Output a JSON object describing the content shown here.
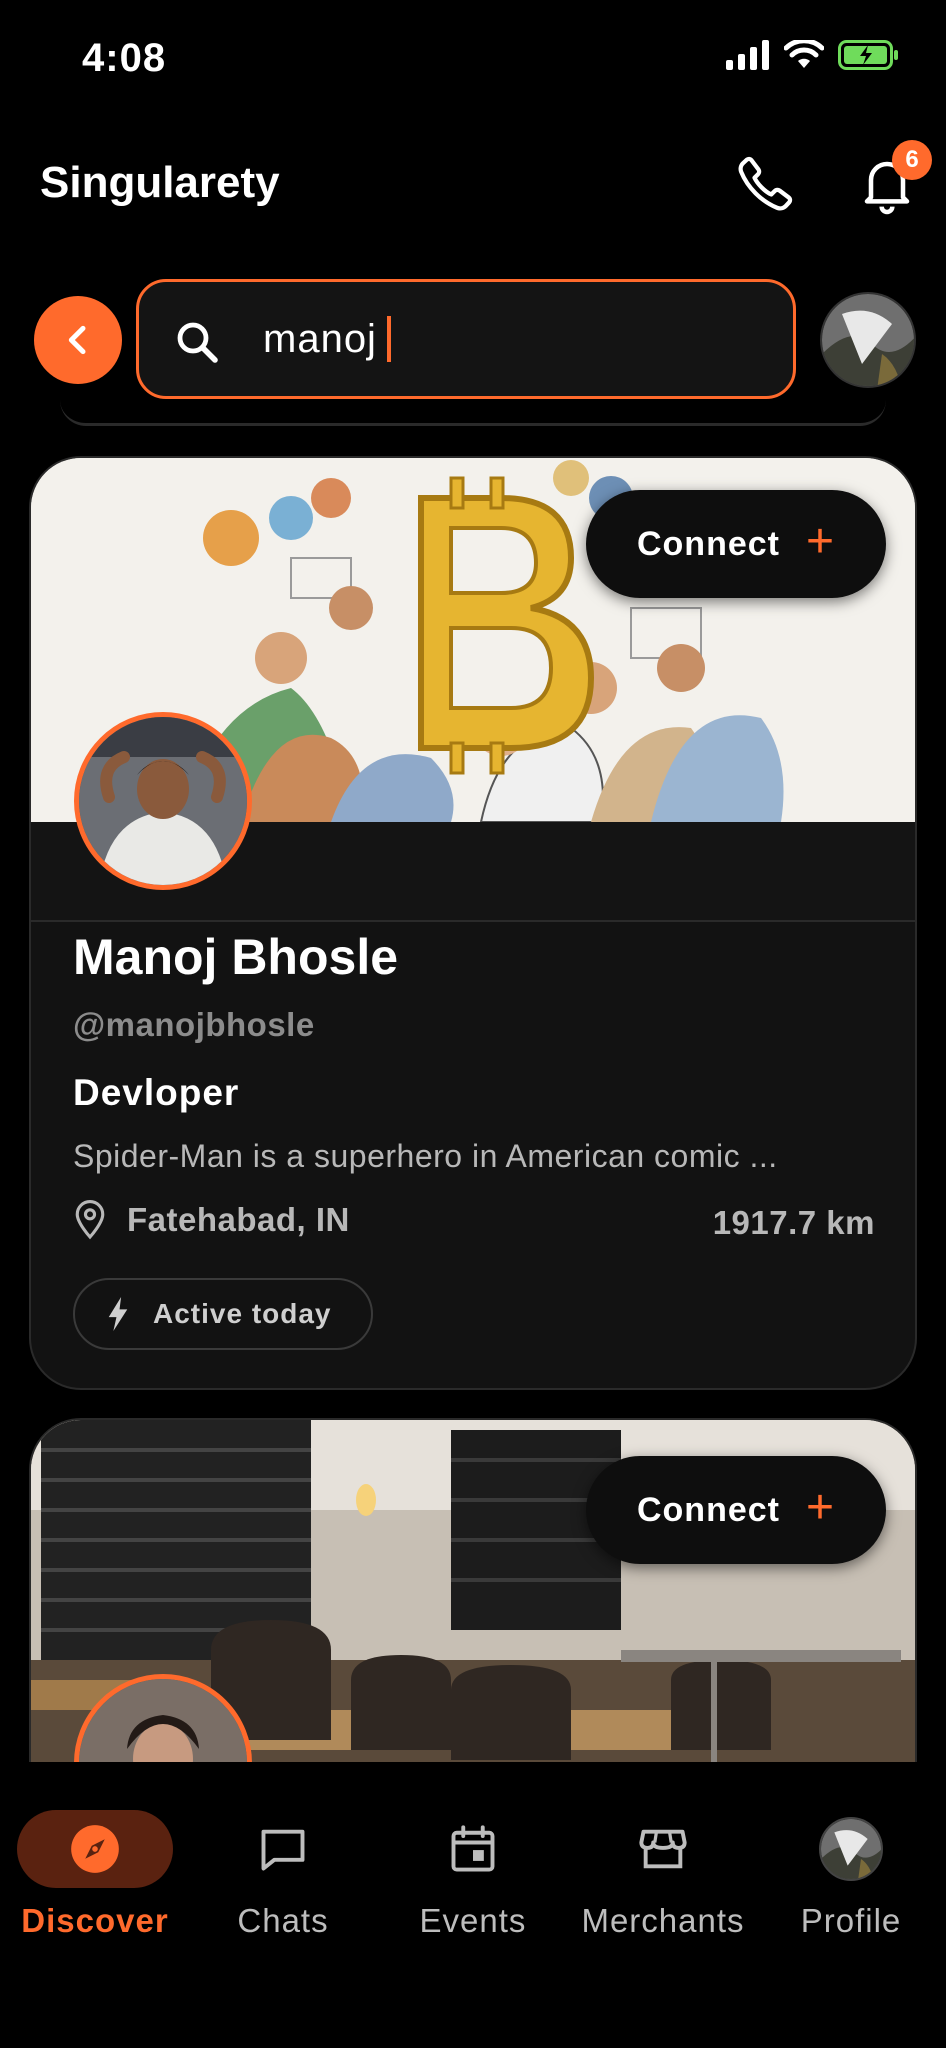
{
  "status_bar": {
    "time": "4:08"
  },
  "header": {
    "title": "Singularety",
    "notification_count": "6"
  },
  "search": {
    "value": "manoj"
  },
  "results": [
    {
      "connect_label": "Connect",
      "name": "Manoj Bhosle",
      "handle": "@manojbhosle",
      "role": "Devloper",
      "bio": "Spider-Man is a superhero in American comic ...",
      "location": "Fatehabad, IN",
      "distance": "1917.7 km",
      "activity": "Active today"
    },
    {
      "connect_label": "Connect"
    }
  ],
  "bottom_nav": [
    {
      "label": "Discover",
      "icon": "compass-icon",
      "active": true
    },
    {
      "label": "Chats",
      "icon": "chat-bubble-icon",
      "active": false
    },
    {
      "label": "Events",
      "icon": "calendar-icon",
      "active": false
    },
    {
      "label": "Merchants",
      "icon": "storefront-icon",
      "active": false
    },
    {
      "label": "Profile",
      "icon": "profile-avatar",
      "active": false
    }
  ],
  "colors": {
    "accent": "#ff6a2c",
    "background": "#000000",
    "card": "#121212"
  }
}
